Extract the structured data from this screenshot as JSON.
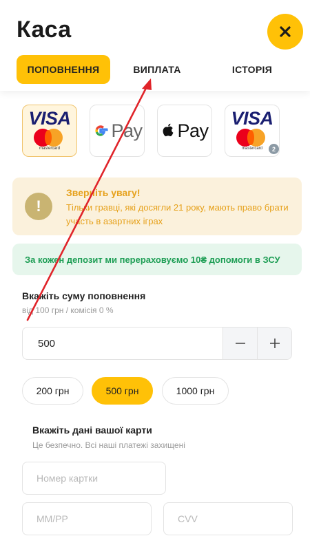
{
  "header": {
    "title": "Каса",
    "close_icon": "close-icon"
  },
  "tabs": [
    {
      "label": "ПОПОВНЕННЯ",
      "active": true
    },
    {
      "label": "ВИПЛАТА",
      "active": false
    },
    {
      "label": "ІСТОРІЯ",
      "active": false
    }
  ],
  "payment_methods": [
    {
      "id": "visa-mastercard",
      "visa": "VISA",
      "mastercard": "mastercard",
      "selected": true
    },
    {
      "id": "google-pay",
      "label": "Pay",
      "selected": false
    },
    {
      "id": "apple-pay",
      "label": "Pay",
      "selected": false
    },
    {
      "id": "visa-mastercard-saved",
      "visa": "VISA",
      "mastercard": "mastercard",
      "badge": "2",
      "selected": false
    }
  ],
  "warning": {
    "icon": "!",
    "title": "Зверніть увагу!",
    "text": "Тільки гравці, які досягли 21 року, мають право брати участь в азартних іграх"
  },
  "info_banner": {
    "text": "За кожен депозит ми перераховуємо 10₴ допомоги в ЗСУ"
  },
  "amount": {
    "label": "Вкажіть суму поповнення",
    "hint": "від 100 грн / комісія 0 %",
    "value": "500",
    "presets": [
      {
        "label": "200 грн",
        "active": false
      },
      {
        "label": "500 грн",
        "active": true
      },
      {
        "label": "1000 грн",
        "active": false
      }
    ]
  },
  "card": {
    "label": "Вкажіть дані вашої карти",
    "hint": "Це безпечно. Всі наші платежі захищені",
    "number_placeholder": "Номер картки",
    "expiry_placeholder": "ММ/РР",
    "cvv_placeholder": "CVV"
  },
  "colors": {
    "accent": "#ffc107",
    "warning_text": "#e6a11b",
    "success_text": "#1e9e55",
    "annotation_arrow": "#e0242a"
  }
}
